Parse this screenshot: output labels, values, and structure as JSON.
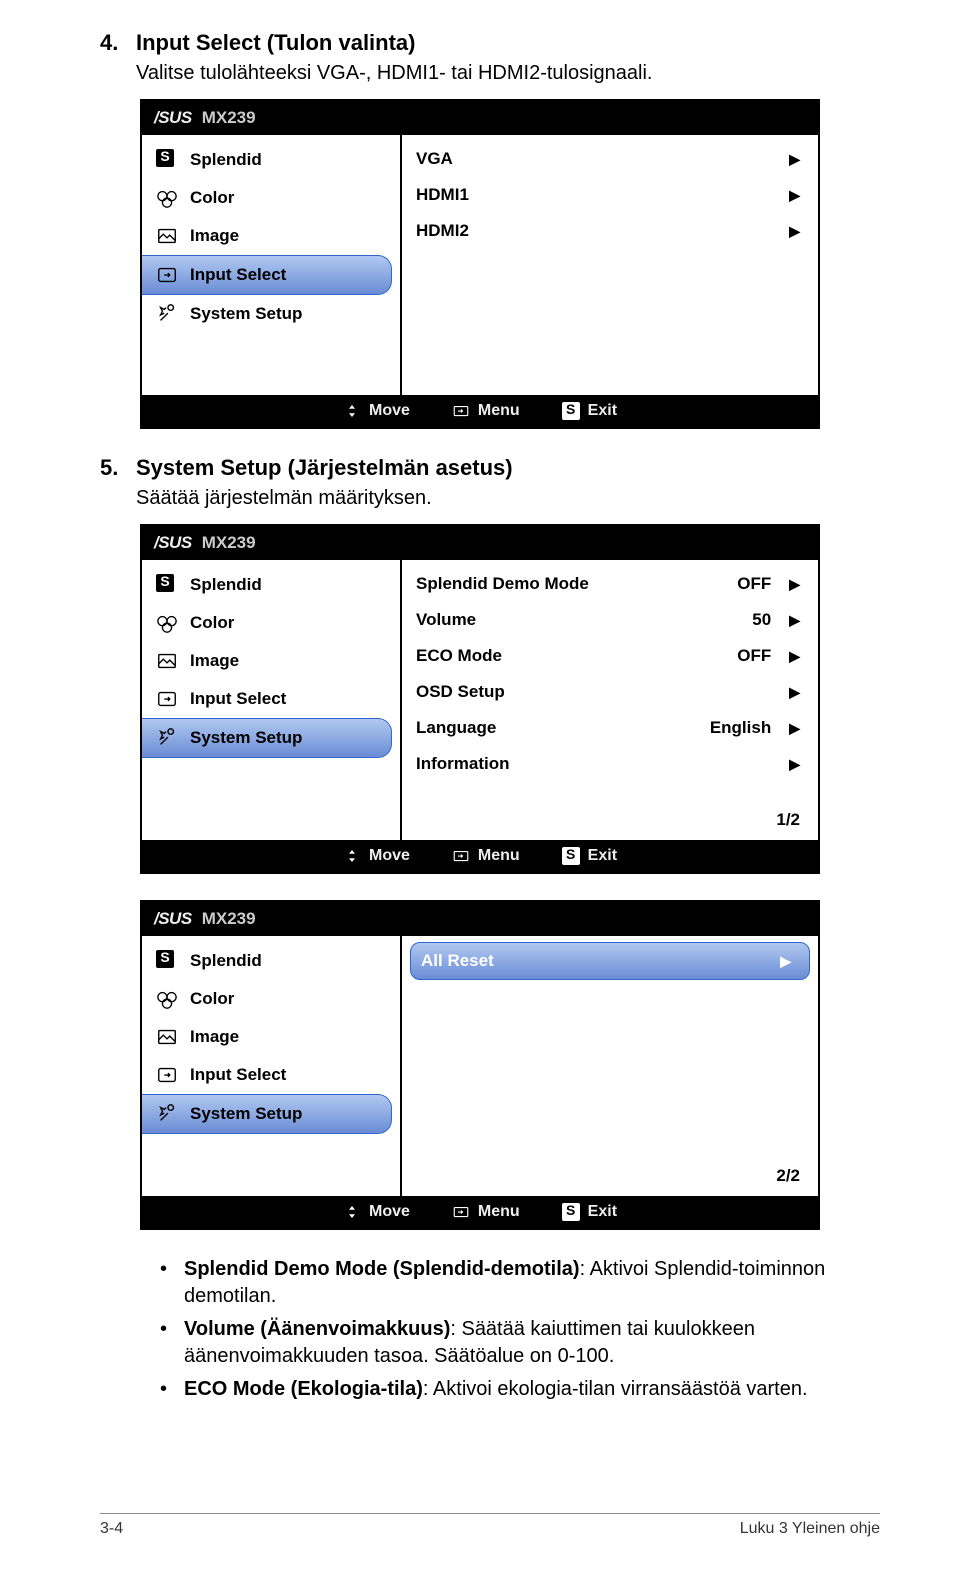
{
  "section4": {
    "num": "4.",
    "title": "Input Select (Tulon valinta)",
    "subtitle": "Valitse tulolähteeksi VGA-, HDMI1- tai HDMI2-tulosignaali."
  },
  "section5": {
    "num": "5.",
    "title": "System Setup (Järjestelmän asetus)",
    "subtitle": "Säätää järjestelmän määrityksen."
  },
  "osd": {
    "model": "MX239",
    "sidebar": {
      "splendid": "Splendid",
      "color": "Color",
      "image": "Image",
      "input_select": "Input Select",
      "system_setup": "System Setup"
    },
    "footer": {
      "move": "Move",
      "menu": "Menu",
      "exit": "Exit"
    },
    "panel1_items": {
      "vga": "VGA",
      "hdmi1": "HDMI1",
      "hdmi2": "HDMI2"
    },
    "panel2_items": {
      "splendid_demo": {
        "label": "Splendid Demo Mode",
        "value": "OFF"
      },
      "volume": {
        "label": "Volume",
        "value": "50"
      },
      "eco": {
        "label": "ECO Mode",
        "value": "OFF"
      },
      "osd_setup": {
        "label": "OSD Setup"
      },
      "language": {
        "label": "Language",
        "value": "English"
      },
      "information": {
        "label": "Information"
      },
      "page": "1/2"
    },
    "panel3_items": {
      "all_reset": "All Reset",
      "page": "2/2"
    }
  },
  "bullets": {
    "b1": "Splendid Demo Mode (Splendid-demotila)",
    "b1_rest": ": Aktivoi Splendid-toiminnon demotilan.",
    "b2": "Volume (Äänenvoimakkuus)",
    "b2_rest": ": Säätää kaiuttimen tai kuulokkeen äänenvoimakkuuden tasoa. Säätöalue on 0-100.",
    "b3": "ECO Mode (Ekologia-tila)",
    "b3_rest": ": Aktivoi ekologia-tilan virransäästöä varten."
  },
  "footer": {
    "left": "3-4",
    "right": "Luku 3 Yleinen ohje"
  }
}
